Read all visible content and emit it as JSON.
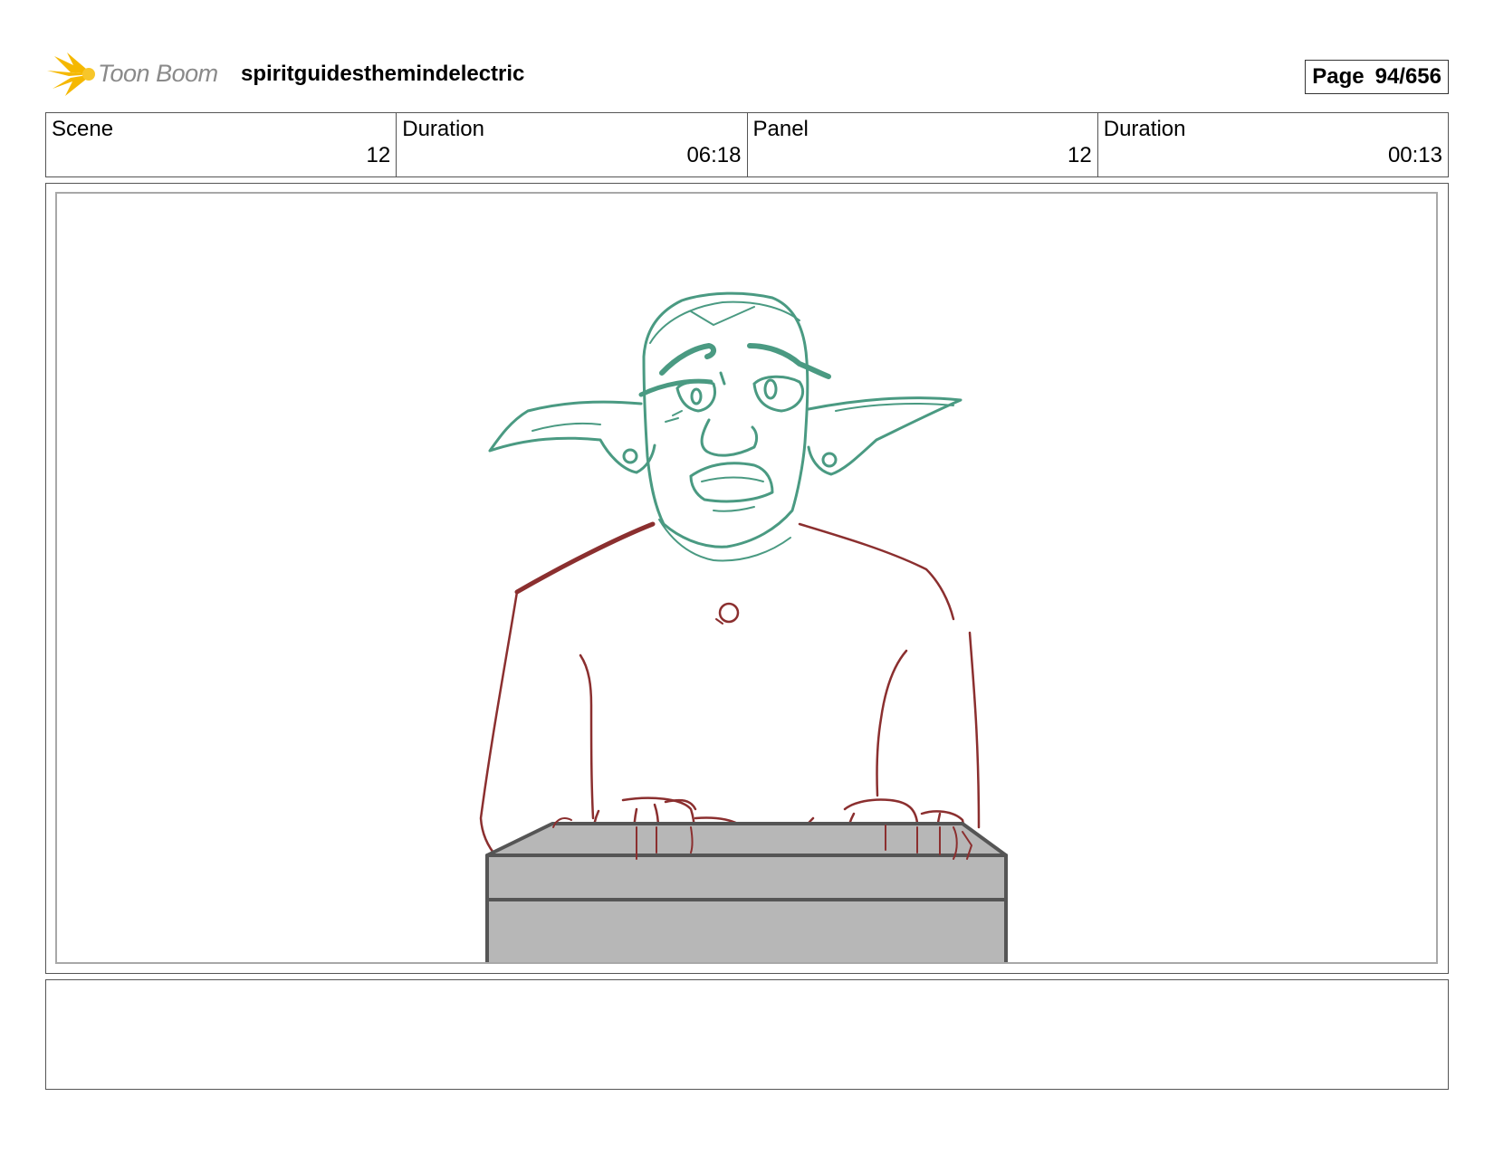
{
  "header": {
    "brand": "Toon Boom",
    "project_title": "spiritguidesthemindelectric",
    "page_label": "Page",
    "page_number": "94/656"
  },
  "info": {
    "scene_label": "Scene",
    "scene_value": "12",
    "scene_duration_label": "Duration",
    "scene_duration_value": "06:18",
    "panel_label": "Panel",
    "panel_value": "12",
    "panel_duration_label": "Duration",
    "panel_duration_value": "00:13"
  },
  "notes": {
    "text": ""
  },
  "colors": {
    "head_lines": "#4a9a82",
    "body_lines": "#8b2f2f",
    "desk_fill": "#b7b7b7",
    "desk_stroke": "#555555",
    "logo_star": "#f5b800"
  }
}
